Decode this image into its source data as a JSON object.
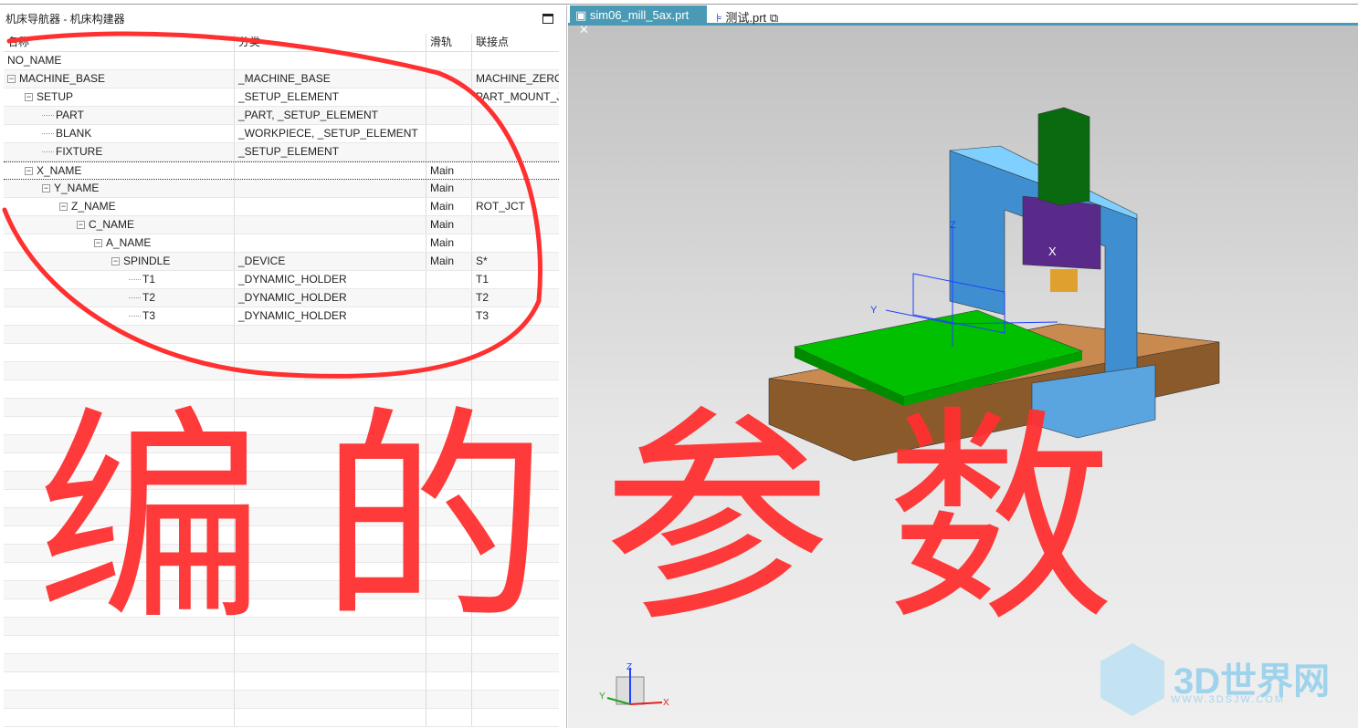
{
  "navigator": {
    "title": "机床导航器 - 机床构建器",
    "columns": [
      "名称",
      "分类",
      "滑轨",
      "联接点"
    ],
    "rows": [
      {
        "name": "NO_NAME",
        "type": "",
        "rail": "",
        "joint": "",
        "level": 0,
        "exp": false
      },
      {
        "name": "MACHINE_BASE",
        "type": "_MACHINE_BASE",
        "rail": "",
        "joint": "MACHINE_ZERO",
        "level": 0,
        "exp": true
      },
      {
        "name": "SETUP",
        "type": "_SETUP_ELEMENT",
        "rail": "",
        "joint": "PART_MOUNT_JCT",
        "level": 1,
        "exp": true
      },
      {
        "name": "PART",
        "type": "_PART, _SETUP_ELEMENT",
        "rail": "",
        "joint": "",
        "level": 2,
        "exp": false
      },
      {
        "name": "BLANK",
        "type": "_WORKPIECE, _SETUP_ELEMENT",
        "rail": "",
        "joint": "",
        "level": 2,
        "exp": false
      },
      {
        "name": "FIXTURE",
        "type": "_SETUP_ELEMENT",
        "rail": "",
        "joint": "",
        "level": 2,
        "exp": false
      },
      {
        "name": "X_NAME",
        "type": "",
        "rail": "Main",
        "joint": "",
        "level": 1,
        "exp": true,
        "selected": true
      },
      {
        "name": "Y_NAME",
        "type": "",
        "rail": "Main",
        "joint": "",
        "level": 2,
        "exp": true
      },
      {
        "name": "Z_NAME",
        "type": "",
        "rail": "Main",
        "joint": "ROT_JCT",
        "level": 3,
        "exp": true
      },
      {
        "name": "C_NAME",
        "type": "",
        "rail": "Main",
        "joint": "",
        "level": 4,
        "exp": true
      },
      {
        "name": "A_NAME",
        "type": "",
        "rail": "Main",
        "joint": "",
        "level": 5,
        "exp": true
      },
      {
        "name": "SPINDLE",
        "type": "_DEVICE",
        "rail": "Main",
        "joint": "S*",
        "level": 6,
        "exp": true
      },
      {
        "name": "T1",
        "type": "_DYNAMIC_HOLDER",
        "rail": "",
        "joint": "T1",
        "level": 7,
        "exp": false
      },
      {
        "name": "T2",
        "type": "_DYNAMIC_HOLDER",
        "rail": "",
        "joint": "T2",
        "level": 7,
        "exp": false
      },
      {
        "name": "T3",
        "type": "_DYNAMIC_HOLDER",
        "rail": "",
        "joint": "T3",
        "level": 7,
        "exp": false
      }
    ]
  },
  "tabs": [
    {
      "label": "sim06_mill_5ax.prt",
      "close": "✕",
      "active": true
    },
    {
      "label": "测试.prt",
      "active": false
    }
  ],
  "annotation_text": "编的参数",
  "axes": {
    "x": "X",
    "y": "Y",
    "z": "Z"
  },
  "watermark": {
    "brand": "3D世界网",
    "url": "WWW.3DSJW.COM"
  },
  "colors": {
    "tab_active": "#4a9ab5",
    "annotation": "#ff3030",
    "table": "#00b400",
    "column": "#3f8fd0",
    "head": "#5a2a8a",
    "ram": "#0a6a10",
    "base": "#8b5a2b"
  }
}
